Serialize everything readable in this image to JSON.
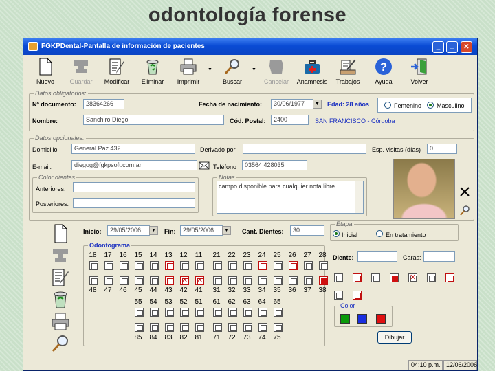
{
  "slide_title": "odontología forense",
  "window": {
    "title": "FGKPDental-Pantalla de información de pacientes"
  },
  "toolbar": {
    "items": [
      {
        "label": "Nuevo",
        "icon": "new-document-icon"
      },
      {
        "label": "Guardar",
        "icon": "anvil-icon"
      },
      {
        "label": "Modificar",
        "icon": "edit-document-icon"
      },
      {
        "label": "Eliminar",
        "icon": "recycle-bin-icon"
      },
      {
        "label": "Imprimir",
        "icon": "printer-icon"
      },
      {
        "label": "Buscar",
        "icon": "magnifier-icon"
      },
      {
        "label": "Cancelar",
        "icon": "cancel-icon"
      },
      {
        "label": "Anamnesis",
        "icon": "first-aid-kit-icon"
      },
      {
        "label": "Trabajos",
        "icon": "tools-icon"
      },
      {
        "label": "Ayuda",
        "icon": "help-icon"
      },
      {
        "label": "Volver",
        "icon": "exit-door-icon"
      }
    ]
  },
  "datos_obligatorios": {
    "legend": "Datos obligatorios:",
    "nro_documento_label": "Nº documento:",
    "nro_documento": "28364266",
    "fecha_label": "Fecha de nacimiento:",
    "fecha": "30/06/1977",
    "edad_label": "Edad: 28 años",
    "sexo_femenino": "Femenino",
    "sexo_masculino": "Masculino",
    "nombre_label": "Nombre:",
    "nombre": "Sanchiro Diego",
    "cp_label": "Cód. Postal:",
    "cp": "2400",
    "localidad": "SAN FRANCISCO - Córdoba"
  },
  "datos_opcionales": {
    "legend": "Datos opcionales:",
    "domicilio_label": "Domicilio",
    "domicilio": "General Paz 432",
    "derivado_label": "Derivado por",
    "derivado": "",
    "esp_label": "Esp. visitas (días)",
    "esp": "0",
    "email_label": "E-mail:",
    "email": "diegog@fgkpsoft.com.ar",
    "telefono_label": "Teléfono",
    "telefono": "03564 428035",
    "color_legend": "Color dientes",
    "anteriores_label": "Anteriores:",
    "anteriores": "",
    "posteriores_label": "Posteriores:",
    "posteriores": "",
    "notas_legend": "Notas",
    "notas": "campo disponible para cualquier nota libre"
  },
  "odonto": {
    "inicio_label": "Inicio:",
    "inicio": "29/05/2006",
    "fin_label": "Fin:",
    "fin": "29/05/2006",
    "cant_label": "Cant. Dientes:",
    "cant": "30",
    "etapa_legend": "Etapa",
    "etapa_inicial": "Inicial",
    "etapa_tratamiento": "En tratamiento",
    "legend": "Odontograma",
    "row1": [
      "18",
      "17",
      "16",
      "15",
      "14",
      "13",
      "12",
      "11",
      "21",
      "22",
      "23",
      "24",
      "25",
      "26",
      "27",
      "28"
    ],
    "row2": [
      "48",
      "47",
      "46",
      "45",
      "44",
      "43",
      "42",
      "41",
      "31",
      "32",
      "33",
      "34",
      "35",
      "36",
      "37",
      "38"
    ],
    "row3": [
      "55",
      "54",
      "53",
      "52",
      "51",
      "61",
      "62",
      "63",
      "64",
      "65"
    ],
    "row4": [
      "85",
      "84",
      "83",
      "82",
      "81",
      "71",
      "72",
      "73",
      "74",
      "75"
    ],
    "diente_label": "Diente:",
    "diente": "",
    "caras_label": "Caras:",
    "caras": "",
    "color_legend": "Color",
    "colors": [
      "#0a9a0a",
      "#1a2fe0",
      "#e01010"
    ],
    "dibujar": "Dibujar"
  },
  "status": {
    "time": "04:10 p.m.",
    "date": "12/06/2006"
  }
}
